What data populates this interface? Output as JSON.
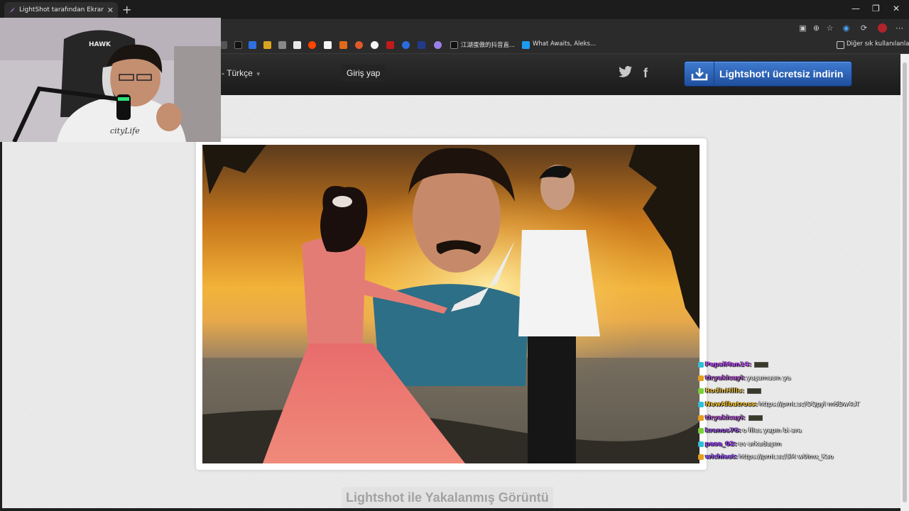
{
  "browser": {
    "tab_title": "LightShot tarafından Ekran Görüntüsü",
    "tab_close": "✕",
    "new_tab": "+",
    "window_controls": [
      "—",
      "❐",
      "✕"
    ],
    "bookmarks": [
      {
        "icon": "tiktok-icon",
        "label": "江湖蛋傲的抖音直..."
      },
      {
        "icon": "twitter-icon",
        "label": "What Awaits, Aleks..."
      }
    ],
    "other_bookmarks": "Diğer sık kullanılanlar"
  },
  "site": {
    "language": "- Türkçe",
    "login": "Giriş yap",
    "download_button": "Lightshot'ı ücretsiz indirin",
    "twitter_glyph": "🐦",
    "facebook_glyph": "f",
    "caption": "Lightshot ile Yakalanmış Görüntü"
  },
  "webcam": {
    "headset_brand": "HAWK",
    "shirt_text": "cityLife"
  },
  "chat": [
    {
      "user": "PepsiMan14:",
      "user_color": "#c04cff",
      "message": "",
      "emote": true
    },
    {
      "user": "tiryakicayi:",
      "user_color": "#b455d6",
      "message": "yaşamasın ya",
      "emote": false
    },
    {
      "user": "RodinHills:",
      "user_color": "#e7c24a",
      "message": "",
      "emote": true
    },
    {
      "user": "NewAlbatross:",
      "user_color": "#f0c030",
      "message": "https://prnt.sc/OQpyl m6Dw4sT",
      "emote": false
    },
    {
      "user": "tiryakicayi:",
      "user_color": "#b455d6",
      "message": "",
      "emote": true
    },
    {
      "user": "kranos76:",
      "user_color": "#9a55e0",
      "message": "o files yapın bi ara",
      "emote": false
    },
    {
      "user": "pasa_02:",
      "user_color": "#a040ff",
      "message": "ev arkadaşım",
      "emote": false
    },
    {
      "user": "wichiest:",
      "user_color": "#9a55ff",
      "message": "https://prnt.sc/SM w0imx_Kso",
      "emote": false
    }
  ]
}
